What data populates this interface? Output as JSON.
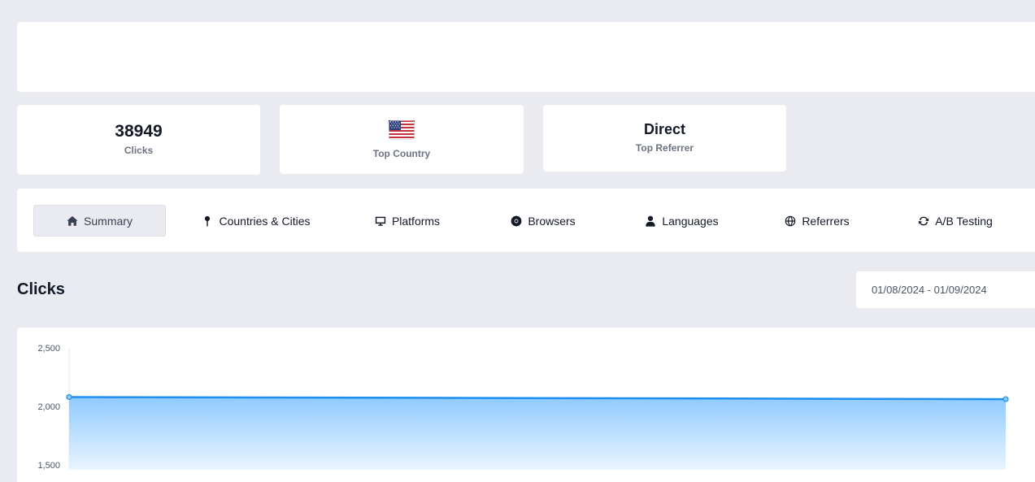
{
  "stats": {
    "clicks": {
      "value": "38949",
      "label": "Clicks"
    },
    "country": {
      "label": "Top Country",
      "flag_icon": "us-flag-icon"
    },
    "referrer": {
      "value": "Direct",
      "label": "Top Referrer"
    }
  },
  "tabs": [
    {
      "label": "Summary",
      "icon": "home-icon",
      "active": true
    },
    {
      "label": "Countries & Cities",
      "icon": "map-pin-icon",
      "active": false
    },
    {
      "label": "Platforms",
      "icon": "monitor-icon",
      "active": false
    },
    {
      "label": "Browsers",
      "icon": "chrome-icon",
      "active": false
    },
    {
      "label": "Languages",
      "icon": "user-icon",
      "active": false
    },
    {
      "label": "Referrers",
      "icon": "globe-icon",
      "active": false
    },
    {
      "label": "A/B Testing",
      "icon": "refresh-icon",
      "active": false
    }
  ],
  "section_title": "Clicks",
  "date_range": "01/08/2024 - 01/09/2024",
  "colors": {
    "accent": "#1d8ff0",
    "fill_top": "#8fcaff",
    "fill_bottom": "#eaf5ff"
  },
  "chart_data": {
    "type": "area",
    "title": "",
    "xlabel": "",
    "ylabel": "",
    "ylim": [
      1500,
      2500
    ],
    "yticks": [
      "2,500",
      "2,000",
      "1,500"
    ],
    "ytick_values": [
      2500,
      2000,
      1500
    ],
    "x": [
      "01/08/2024",
      "01/09/2024"
    ],
    "series": [
      {
        "values": [
          2080,
          2062
        ]
      }
    ],
    "grid": false,
    "legend": "none"
  }
}
